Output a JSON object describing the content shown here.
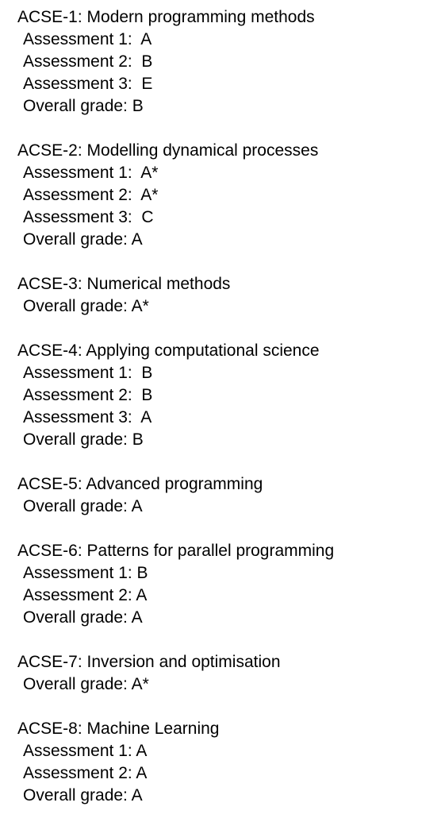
{
  "modules": [
    {
      "title": "ACSE-1: Modern programming methods",
      "rows": [
        "Assessment 1:  A",
        "Assessment 2:  B",
        "Assessment 3:  E",
        "Overall grade: B"
      ]
    },
    {
      "title": "ACSE-2: Modelling dynamical processes",
      "rows": [
        "Assessment 1:  A*",
        "Assessment 2:  A*",
        "Assessment 3:  C",
        "Overall grade: A"
      ]
    },
    {
      "title": "ACSE-3: Numerical methods",
      "rows": [
        "Overall grade: A*"
      ]
    },
    {
      "title": "ACSE-4: Applying computational science",
      "rows": [
        "Assessment 1:  B",
        "Assessment 2:  B",
        "Assessment 3:  A",
        "Overall grade: B"
      ]
    },
    {
      "title": "ACSE-5: Advanced programming",
      "rows": [
        "Overall grade: A"
      ]
    },
    {
      "title": "ACSE-6: Patterns for parallel programming",
      "rows": [
        "Assessment 1: B",
        "Assessment 2: A",
        "Overall grade: A"
      ]
    },
    {
      "title": "ACSE-7: Inversion and optimisation",
      "rows": [
        "Overall grade: A*"
      ]
    },
    {
      "title": "ACSE-8: Machine Learning",
      "rows": [
        "Assessment 1: A",
        "Assessment 2: A",
        "Overall grade: A"
      ]
    }
  ]
}
